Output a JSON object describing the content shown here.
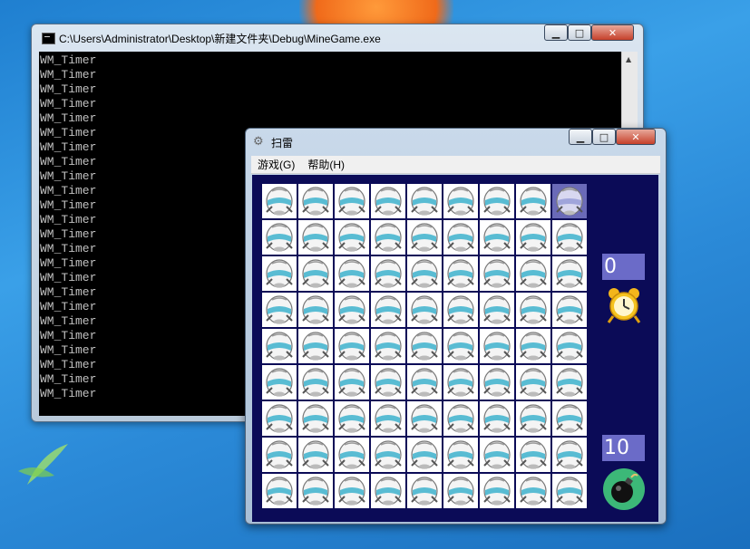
{
  "console": {
    "title": "C:\\Users\\Administrator\\Desktop\\新建文件夹\\Debug\\MineGame.exe",
    "lines": [
      "WM_Timer",
      "WM_Timer",
      "WM_Timer",
      "WM_Timer",
      "WM_Timer",
      "WM_Timer",
      "WM_Timer",
      "WM_Timer",
      "WM_Timer",
      "WM_Timer",
      "WM_Timer",
      "WM_Timer",
      "WM_Timer",
      "WM_Timer",
      "WM_Timer",
      "WM_Timer",
      "WM_Timer",
      "WM_Timer",
      "WM_Timer",
      "WM_Timer",
      "WM_Timer",
      "WM_Timer",
      "WM_Timer",
      "WM_Timer"
    ]
  },
  "mine": {
    "title": "扫雷",
    "menu": {
      "game": "游戏(G)",
      "help": "帮助(H)"
    },
    "rows": 9,
    "cols": 9,
    "selected_cell": {
      "row": 1,
      "col": 9
    },
    "timer_value": "0",
    "mine_count": "10"
  },
  "icons": {
    "minimize": "minimize-icon",
    "maximize": "maximize-icon",
    "close": "close-icon",
    "cell": "egg-tile-icon",
    "timer": "alarm-clock-icon",
    "mines": "bomb-icon"
  },
  "colors": {
    "game_background": "#0b0b57",
    "counter_background": "#6b6bc8",
    "selected_cell": "#6a6ab8"
  }
}
